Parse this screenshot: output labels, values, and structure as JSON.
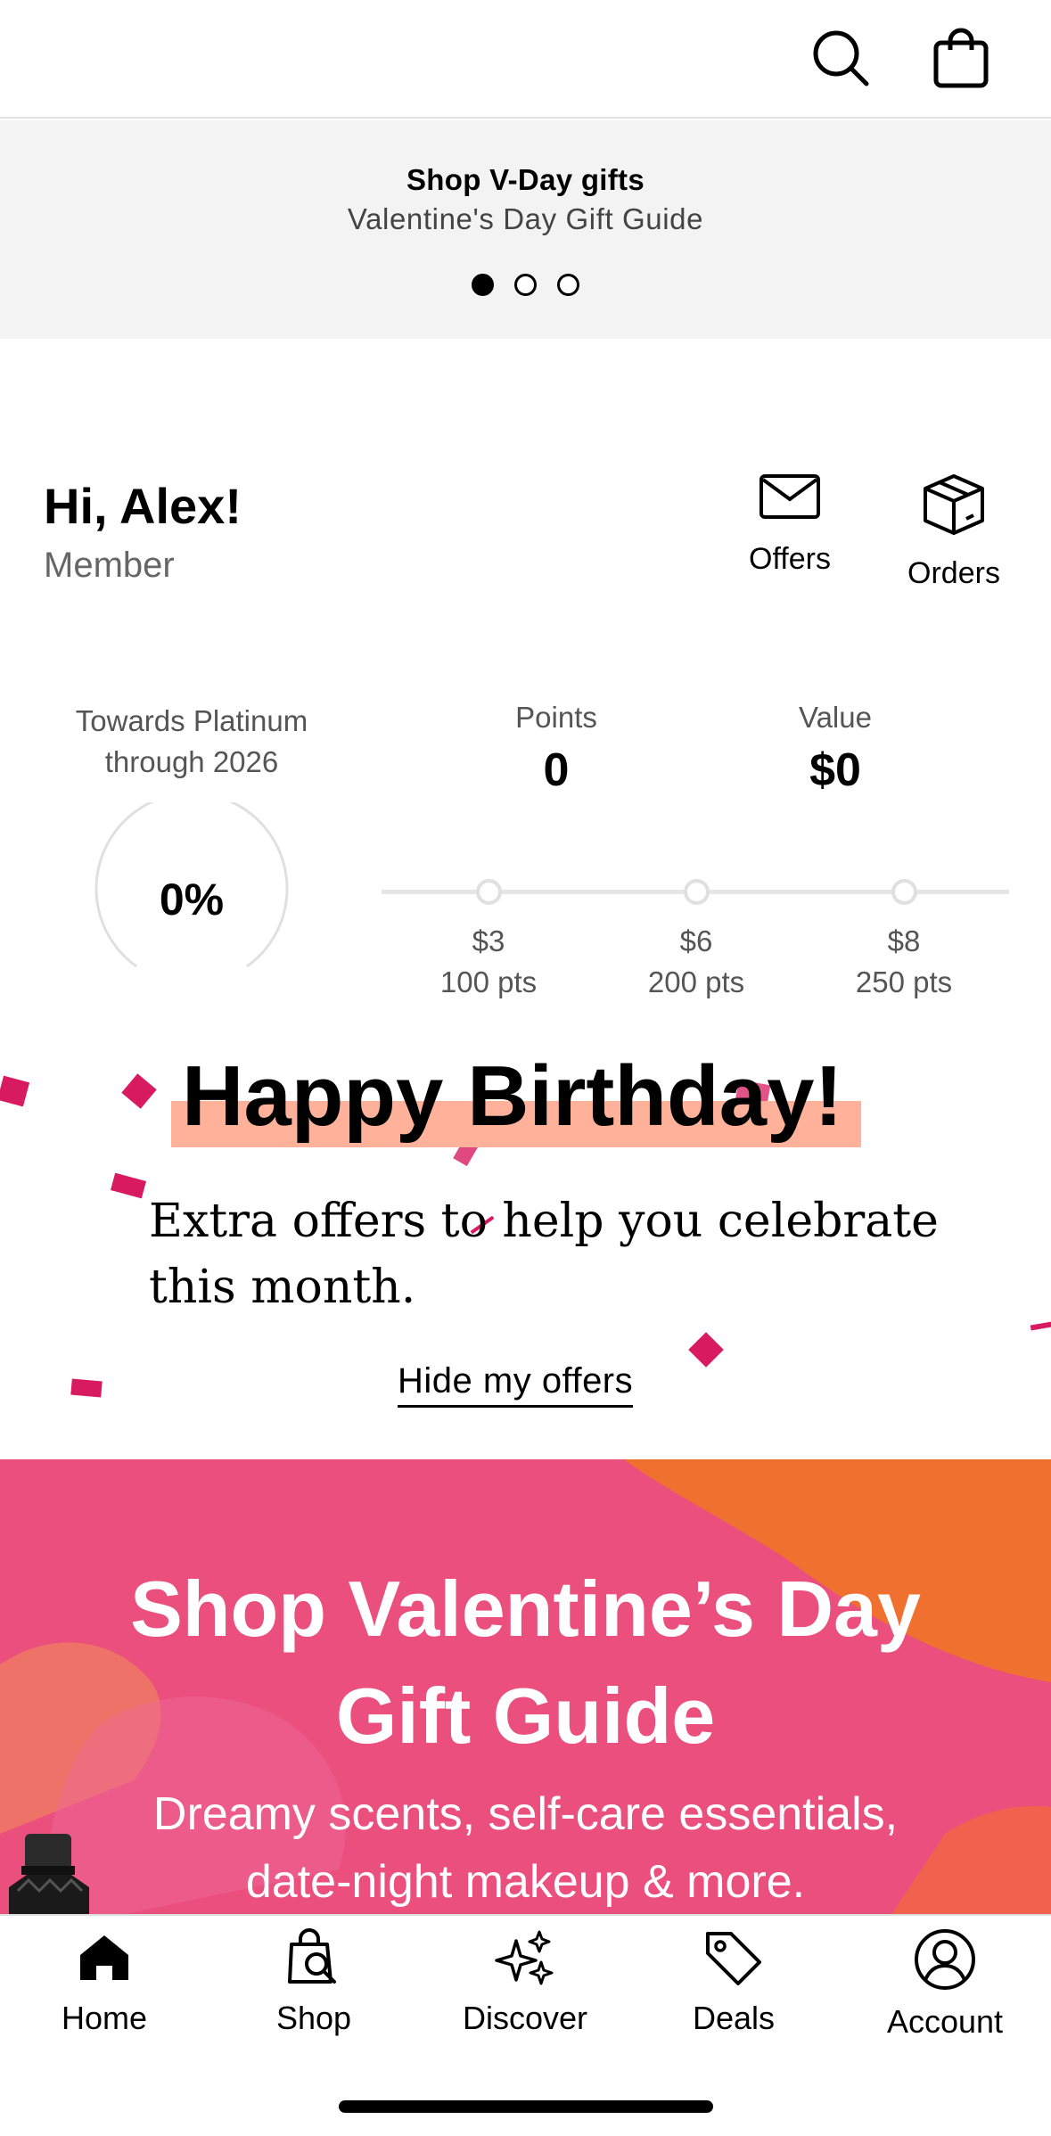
{
  "header": {
    "icons": [
      "search-icon",
      "shopping-bag-icon"
    ]
  },
  "promo": {
    "title": "Shop V-Day gifts",
    "subtitle": "Valentine's Day Gift Guide",
    "page_count": 3,
    "active_index": 0
  },
  "profile": {
    "greeting": "Hi, Alex!",
    "tier": "Member",
    "offers_label": "Offers",
    "orders_label": "Orders"
  },
  "rewards": {
    "progress_label_line1": "Towards Platinum",
    "progress_label_line2": "through 2026",
    "progress_value": "0%",
    "points_label": "Points",
    "points_value": "0",
    "value_label": "Value",
    "value_amount": "$0",
    "milestones": [
      {
        "amount": "$3",
        "points": "100 pts"
      },
      {
        "amount": "$6",
        "points": "200 pts"
      },
      {
        "amount": "$8",
        "points": "250 pts"
      }
    ]
  },
  "birthday": {
    "title": "Happy Birthday!",
    "text": "Extra offers to help you celebrate this month.",
    "hide_link": "Hide my offers"
  },
  "banner": {
    "title_line1": "Shop Valentine’s Day",
    "title_line2": "Gift Guide",
    "subtitle_line1": "Dreamy scents, self-care essentials,",
    "subtitle_line2": "date-night makeup & more."
  },
  "tabbar": {
    "items": [
      {
        "label": "Home",
        "icon": "home-icon"
      },
      {
        "label": "Shop",
        "icon": "shop-bag-search-icon"
      },
      {
        "label": "Discover",
        "icon": "sparkles-icon"
      },
      {
        "label": "Deals",
        "icon": "tag-icon"
      },
      {
        "label": "Account",
        "icon": "account-icon"
      }
    ]
  },
  "colors": {
    "highlight": "#ffb199",
    "confetti": "#d81b60",
    "banner_pink": "#ea4f7e",
    "banner_orange": "#f07030"
  }
}
